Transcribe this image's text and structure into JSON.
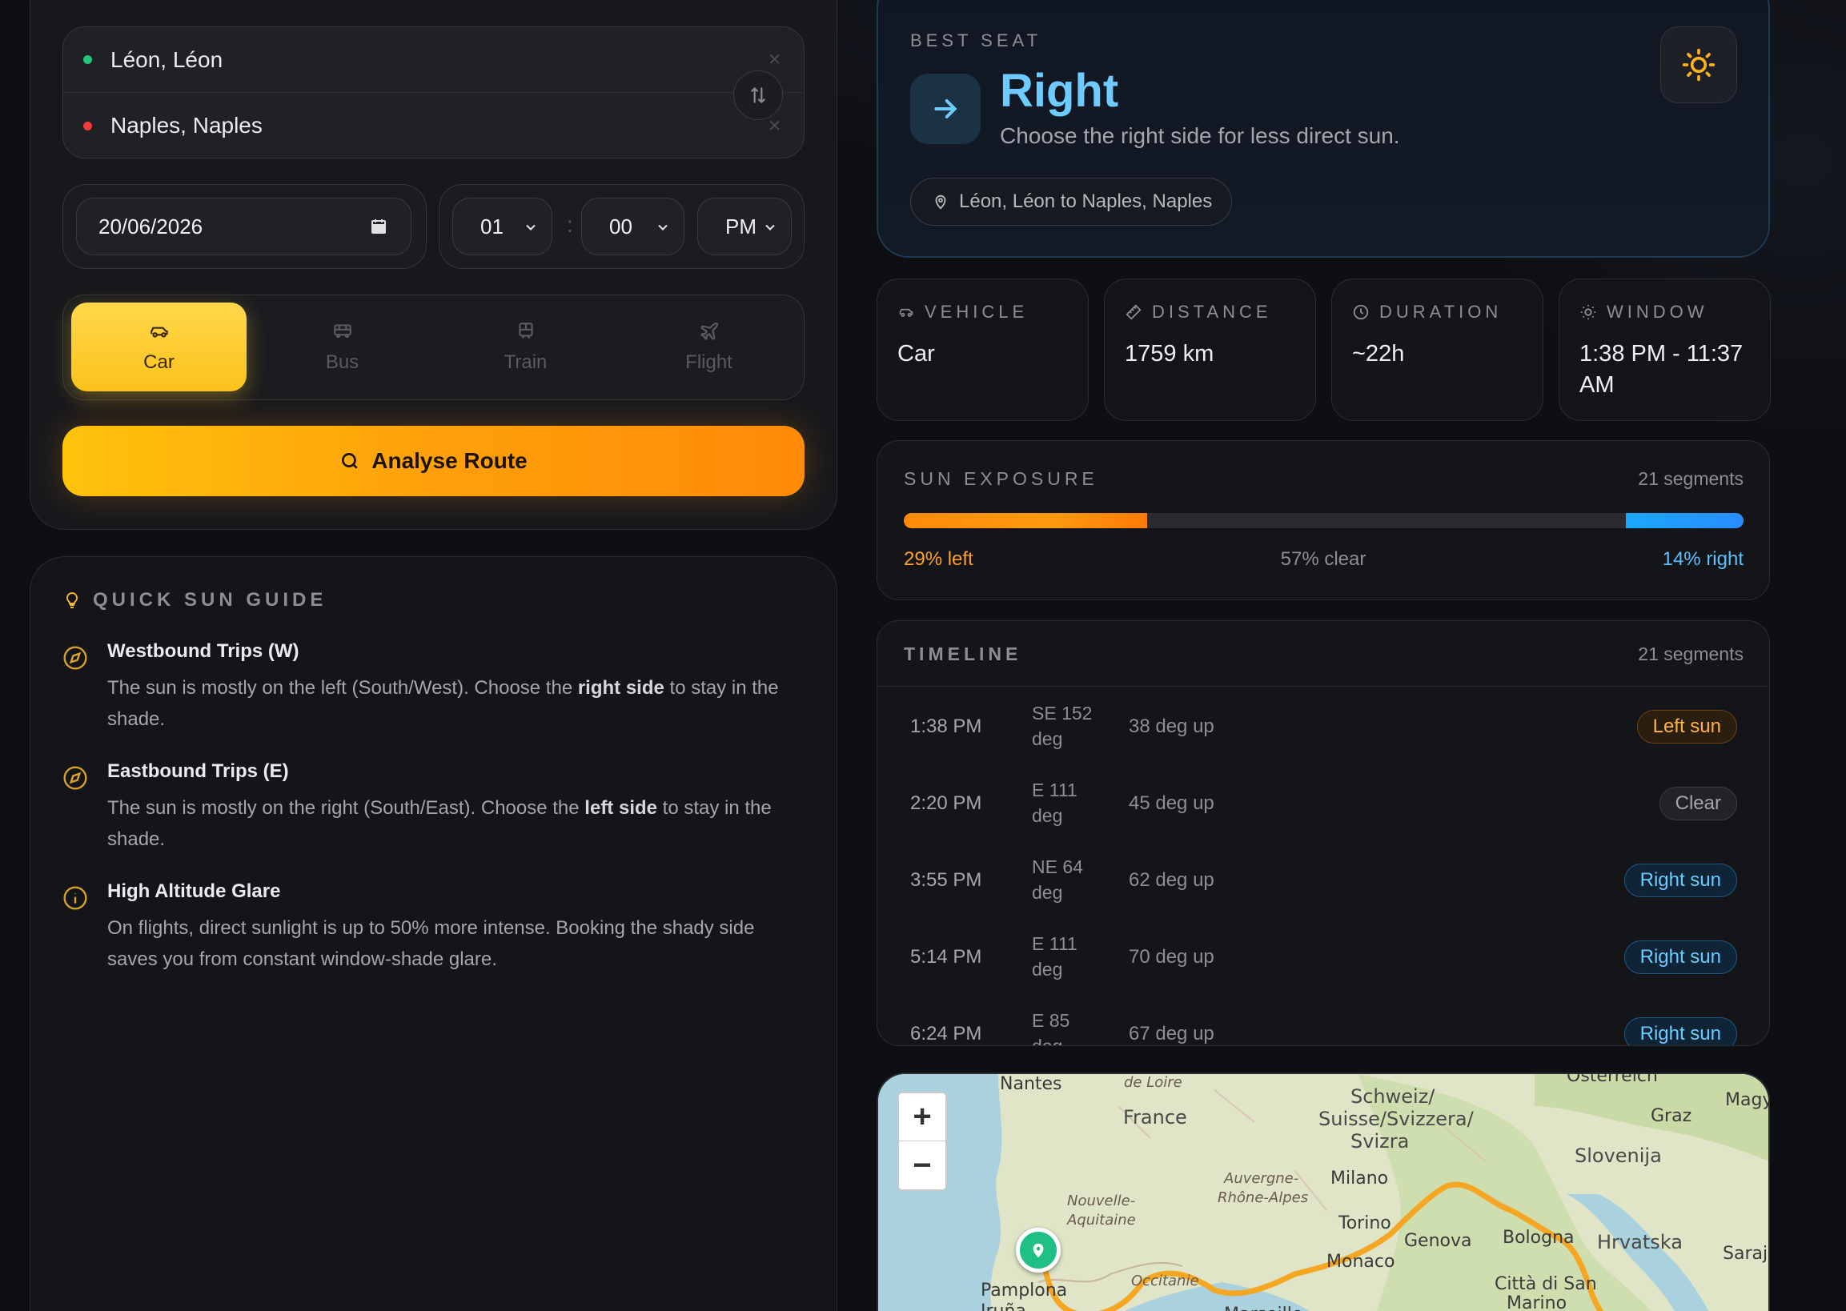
{
  "locations": {
    "origin": "Léon, Léon",
    "destination": "Naples, Naples"
  },
  "trip": {
    "date": "20/06/2026",
    "hour": "01",
    "minute": "00",
    "ampm": "PM",
    "colon": ":"
  },
  "modes": [
    {
      "label": "Car",
      "icon": "car-icon",
      "active": true
    },
    {
      "label": "Bus",
      "icon": "bus-icon",
      "active": false
    },
    {
      "label": "Train",
      "icon": "train-icon",
      "active": false
    },
    {
      "label": "Flight",
      "icon": "plane-icon",
      "active": false
    }
  ],
  "analyse_label": "Analyse Route",
  "guide": {
    "title": "QUICK SUN GUIDE",
    "items": [
      {
        "title": "Westbound Trips (W)",
        "pre": "The sun is mostly on the left (South/West). Choose the ",
        "bold": "right side",
        "post": " to stay in the shade.",
        "icon": "compass-icon"
      },
      {
        "title": "Eastbound Trips (E)",
        "pre": "The sun is mostly on the right (South/East). Choose the ",
        "bold": "left side",
        "post": " to stay in the shade.",
        "icon": "compass-icon"
      },
      {
        "title": "High Altitude Glare",
        "pre": "On flights, direct sunlight is up to 50% more intense. Booking the shady side saves you from constant window-shade glare.",
        "bold": "",
        "post": "",
        "icon": "info-icon"
      }
    ]
  },
  "best_seat": {
    "label": "BEST SEAT",
    "side": "Right",
    "subtitle": "Choose the right side for less direct sun.",
    "route": "Léon, Léon to Naples, Naples"
  },
  "stats": [
    {
      "label": "VEHICLE",
      "value": "Car",
      "icon": "car-icon"
    },
    {
      "label": "DISTANCE",
      "value": "1759 km",
      "icon": "ruler-icon"
    },
    {
      "label": "DURATION",
      "value": "~22h",
      "icon": "clock-icon"
    },
    {
      "label": "WINDOW",
      "value": "1:38 PM - 11:37 AM",
      "icon": "sun-small-icon"
    }
  ],
  "exposure": {
    "title": "SUN EXPOSURE",
    "segments": "21 segments",
    "left_pct": 29,
    "clear_pct": 57,
    "right_pct": 14,
    "left_label": "29% left",
    "clear_label": "57% clear",
    "right_label": "14% right"
  },
  "timeline": {
    "title": "TIMELINE",
    "segments": "21 segments",
    "rows": [
      {
        "time": "1:38 PM",
        "dir1": "SE 152",
        "dir2": "deg",
        "elev": "38 deg up",
        "status": "Left sun",
        "kind": "left"
      },
      {
        "time": "2:20 PM",
        "dir1": "E 111",
        "dir2": "deg",
        "elev": "45 deg up",
        "status": "Clear",
        "kind": "clear"
      },
      {
        "time": "3:55 PM",
        "dir1": "NE 64",
        "dir2": "deg",
        "elev": "62 deg up",
        "status": "Right sun",
        "kind": "right"
      },
      {
        "time": "5:14 PM",
        "dir1": "E 111",
        "dir2": "deg",
        "elev": "70 deg up",
        "status": "Right sun",
        "kind": "right"
      },
      {
        "time": "6:24 PM",
        "dir1": "E 85",
        "dir2": "deg",
        "elev": "67 deg up",
        "status": "Right sun",
        "kind": "right"
      }
    ]
  },
  "map": {
    "zoom_in": "+",
    "zoom_out": "−",
    "labels": [
      "Nantes",
      "de Loire",
      "France",
      "Schweiz/",
      "Suisse/Svizzera/",
      "Svizra",
      "Österreich",
      "Graz",
      "Magy",
      "Slovenija",
      "Milano",
      "Auvergne-",
      "Rhône-Alpes",
      "Nouvelle-",
      "Aquitaine",
      "Torino",
      "Genova",
      "Bologna",
      "Hrvatska",
      "Saraje",
      "Monaco",
      "Città di San",
      "Marino",
      "Occitanie",
      "Pamplona",
      "Iruña",
      "Marseille"
    ]
  }
}
